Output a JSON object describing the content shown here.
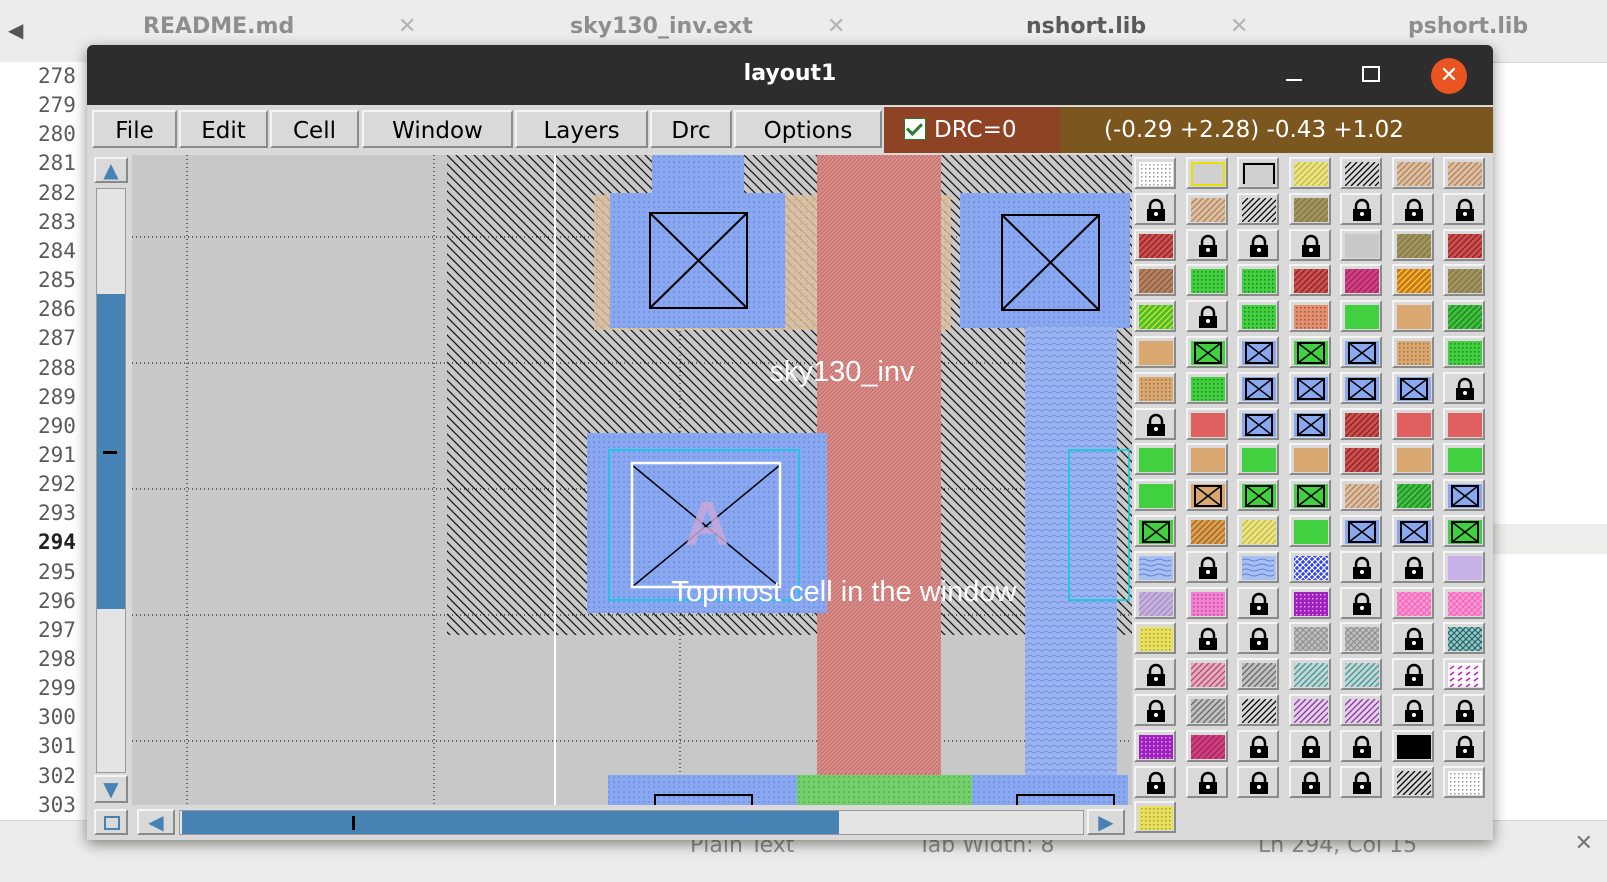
{
  "editor": {
    "tabs": [
      {
        "label": "README.md"
      },
      {
        "label": "sky130_inv.ext"
      },
      {
        "label": "nshort.lib"
      },
      {
        "label": "pshort.lib"
      }
    ],
    "line_numbers": [
      "278",
      "279",
      "280",
      "281",
      "282",
      "283",
      "284",
      "285",
      "286",
      "287",
      "288",
      "289",
      "290",
      "291",
      "292",
      "293",
      "294",
      "295",
      "296",
      "297",
      "298",
      "299",
      "300",
      "301",
      "302",
      "303"
    ],
    "current_line": "294",
    "status": {
      "language": "Plain Text",
      "tab_width": "Tab Width: 8",
      "cursor": "Ln 294, Col 15"
    }
  },
  "window": {
    "title": "layout1",
    "menu": [
      "File",
      "Edit",
      "Cell",
      "Window",
      "Layers",
      "Drc",
      "Options"
    ],
    "drc": {
      "label": "DRC=0",
      "checked": true
    },
    "coordinates": "(-0.29 +2.28) -0.43 +1.02"
  },
  "canvas": {
    "cell_label": "sky130_inv",
    "port_label": "A",
    "hint_label": "Topmost cell in the window"
  },
  "scrollbars": {
    "vertical_thumb_fraction": [
      0.18,
      0.72
    ],
    "horizontal_thumb_fraction": [
      0.0,
      0.73
    ]
  },
  "colors": {
    "drc_bg": "#8e4424",
    "coords_bg": "#7c561f",
    "scroll_blue": "#4682b4",
    "titlebar": "#2d2d2d",
    "close_button": "#e95420",
    "canvas_bg": "#c8c8c8"
  },
  "layer_palette": {
    "columns": 7,
    "rows": 19,
    "cells": [
      "dots-gray",
      "yellow-outline",
      "black-outline",
      "yellow-hatch",
      "black-hatch",
      "tan-hatch",
      "tan-hatch",
      "lock",
      "tan-hatch",
      "black-hatch",
      "olive-hatch",
      "lock",
      "lock",
      "lock",
      "red-hatch",
      "lock",
      "lock",
      "lock",
      "gray",
      "olive-hatch",
      "red-hatch",
      "brown-hatch",
      "green-dots",
      "green-dots",
      "red-hatch",
      "magenta-hatch",
      "yellow-red-hatch",
      "olive-hatch",
      "yellow-green-hatch",
      "lock",
      "green-dots",
      "orange-dots",
      "green",
      "tan",
      "green-hatch",
      "tan",
      "green-contact",
      "blue-contact",
      "green-contact",
      "blue-contact",
      "tan-dots",
      "green-dots",
      "tan-dots",
      "green-dots",
      "blue-contact",
      "blue-contact",
      "blue-contact",
      "blue-contact",
      "lock",
      "lock",
      "red",
      "blue-contact",
      "blue-contact",
      "red-hatch",
      "red",
      "red",
      "green",
      "tan",
      "green",
      "tan",
      "red-hatch",
      "tan",
      "green",
      "green",
      "tan-contact",
      "green-contact",
      "green-contact",
      "tan-hatch",
      "green-hatch",
      "blue-contact",
      "green-contact",
      "orange-hatch",
      "yellow-hatch",
      "green",
      "blue-contact",
      "blue-contact",
      "green-contact",
      "blue-wave",
      "lock",
      "blue-wave",
      "blue-cross",
      "lock",
      "lock",
      "lilac",
      "lilac-hatch",
      "pink-dots",
      "lock",
      "purple-dots",
      "lock",
      "pink-cross",
      "pink-cross",
      "yellow-dots",
      "lock",
      "lock",
      "gray-cross",
      "gray-cross",
      "lock",
      "teal-cross",
      "lock",
      "pink-hatch",
      "gray-hatch",
      "teal-hatch",
      "teal-hatch",
      "lock",
      "magenta-dash",
      "lock",
      "gray-hatch",
      "black-hatch",
      "purple-hatch",
      "purple-hatch",
      "lock",
      "lock",
      "purple-dots",
      "magenta-hatch",
      "lock",
      "lock",
      "lock",
      "black",
      "lock",
      "lock",
      "lock",
      "lock",
      "lock",
      "lock",
      "black-hatch",
      "gray-dots",
      "yellow-dots"
    ]
  }
}
